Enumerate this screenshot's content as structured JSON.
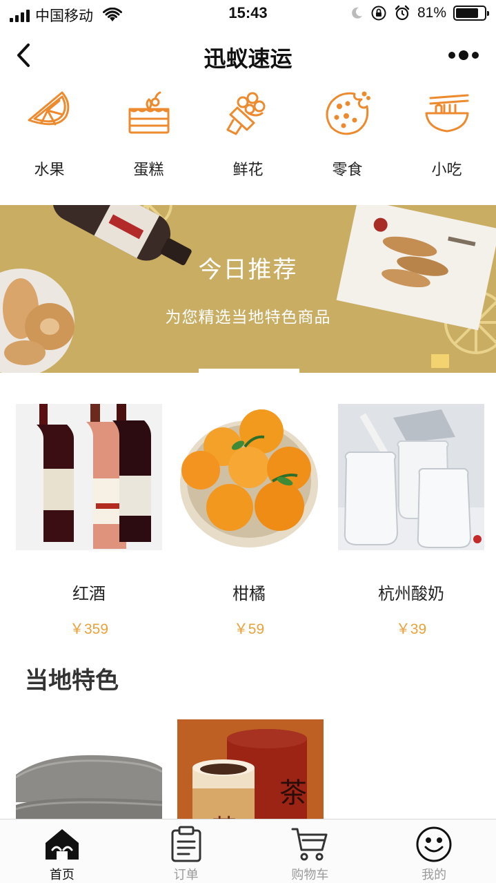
{
  "status_bar": {
    "carrier": "中国移动",
    "time": "15:43",
    "battery": "81%",
    "battery_level": 0.81
  },
  "nav": {
    "title": "迅蚁速运"
  },
  "categories": [
    {
      "label": "水果",
      "icon": "watermelon-slice-icon"
    },
    {
      "label": "蛋糕",
      "icon": "cake-icon"
    },
    {
      "label": "鲜花",
      "icon": "bouquet-icon"
    },
    {
      "label": "零食",
      "icon": "cookie-icon"
    },
    {
      "label": "小吃",
      "icon": "noodle-bowl-icon"
    }
  ],
  "banner": {
    "title": "今日推荐",
    "subtitle": "为您精选当地特色商品"
  },
  "recommended": [
    {
      "name": "红酒",
      "price": "￥359",
      "image": "red-wine-bottles"
    },
    {
      "name": "柑橘",
      "price": "￥59",
      "image": "oranges-in-bowl"
    },
    {
      "name": "杭州酸奶",
      "price": "￥39",
      "image": "yogurt-jars"
    }
  ],
  "local": {
    "title": "当地特色",
    "items": [
      {
        "image": "folded-towels"
      },
      {
        "image": "tea-canisters"
      }
    ]
  },
  "tabs": [
    {
      "label": "首页",
      "icon": "home-icon",
      "active": true
    },
    {
      "label": "订单",
      "icon": "clipboard-icon",
      "active": false
    },
    {
      "label": "购物车",
      "icon": "cart-icon",
      "active": false
    },
    {
      "label": "我的",
      "icon": "smiley-icon",
      "active": false
    }
  ],
  "colors": {
    "accent": "#ee8a2e",
    "price": "#e9a23b",
    "banner": "#c9ad63"
  }
}
